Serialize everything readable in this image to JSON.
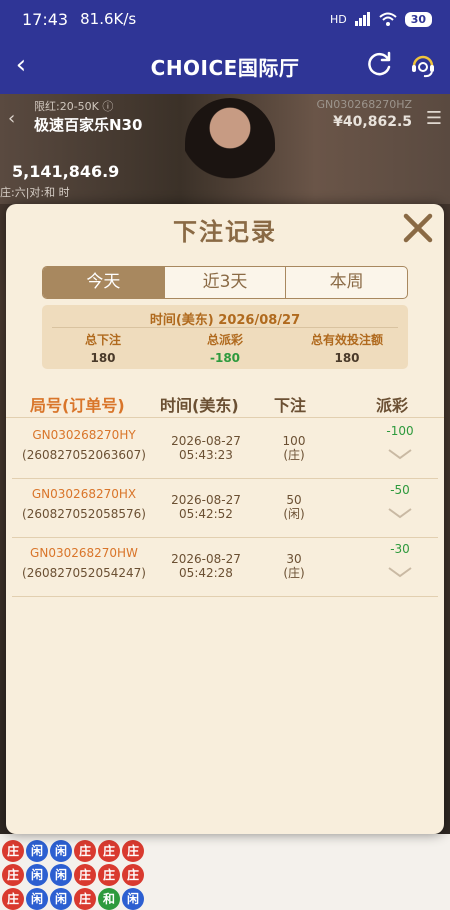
{
  "status_bar": {
    "time": "17:43",
    "speed": "81.6K/s",
    "network": "HD",
    "battery": "30"
  },
  "header": {
    "title": "CHOICE国际厅"
  },
  "game": {
    "limit": "限红:20-50K ⓘ",
    "table_name": "极速百家乐N30",
    "table_id": "GN030268270HZ",
    "balance": "¥40,862.5",
    "pool": "5,141,846.9",
    "roadmap_labels": "庄:六|对:和 时"
  },
  "bead_road": {
    "columns": [
      [
        "庄",
        "庄",
        "庄"
      ],
      [
        "闲",
        "闲",
        "闲"
      ],
      [
        "闲",
        "闲",
        "闲"
      ],
      [
        "庄",
        "庄",
        "庄"
      ],
      [
        "庄",
        "庄",
        "和"
      ],
      [
        "庄",
        "庄",
        "闲"
      ]
    ],
    "colors": {
      "banker": "#d93a2f",
      "player": "#2c5fd1",
      "tie": "#2e9a3d"
    }
  },
  "modal": {
    "title": "下注记录",
    "tabs": [
      {
        "label": "今天",
        "active": true
      },
      {
        "label": "近3天",
        "active": false
      },
      {
        "label": "本周",
        "active": false
      }
    ],
    "summary": {
      "date": "时间(美东) 2026/08/27",
      "total_bet_label": "总下注",
      "total_bet": "180",
      "total_payout_label": "总派彩",
      "total_payout": "-180",
      "valid_bet_label": "总有效投注额",
      "valid_bet": "180"
    },
    "columns": {
      "id": "局号(订单号)",
      "time": "时间(美东)",
      "bet": "下注",
      "payout": "派彩"
    },
    "rows": [
      {
        "round": "GN030268270HY",
        "order": "(260827052063607)",
        "date": "2026-08-27",
        "time": "05:43:23",
        "amount": "100",
        "side": "(庄)",
        "payout": "-100"
      },
      {
        "round": "GN030268270HX",
        "order": "(260827052058576)",
        "date": "2026-08-27",
        "time": "05:42:52",
        "amount": "50",
        "side": "(闲)",
        "payout": "-50"
      },
      {
        "round": "GN030268270HW",
        "order": "(260827052054247)",
        "date": "2026-08-27",
        "time": "05:42:28",
        "amount": "30",
        "side": "(庄)",
        "payout": "-30"
      }
    ]
  }
}
